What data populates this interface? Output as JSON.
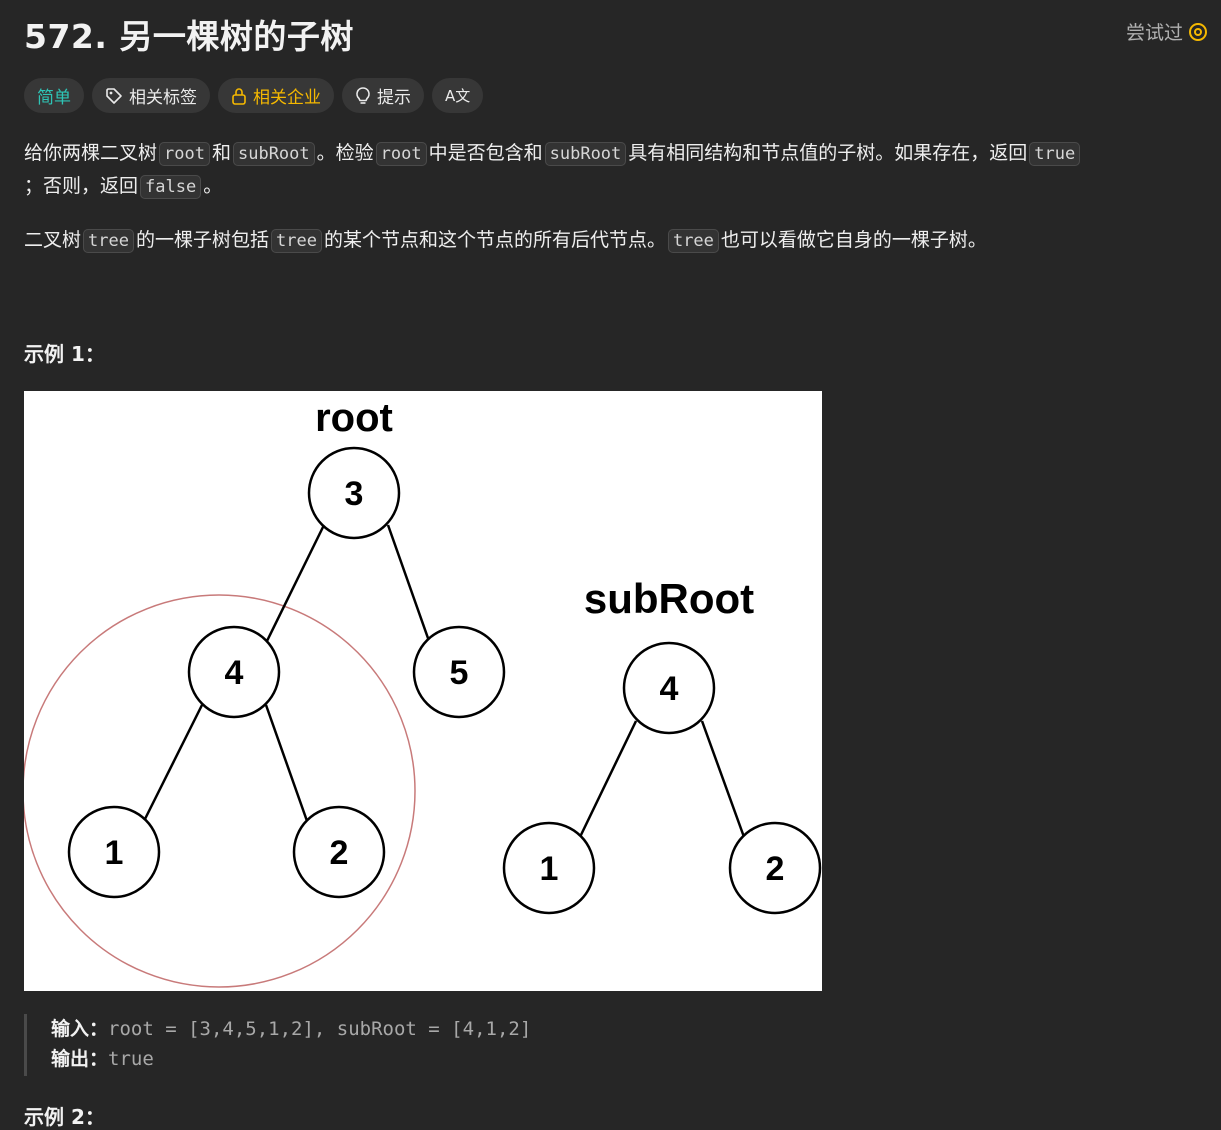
{
  "problem": {
    "title": "572. 另一棵树的子树",
    "tried_label": "尝试过"
  },
  "tags": {
    "difficulty": "简单",
    "related_tags": "相关标签",
    "related_companies": "相关企业",
    "hint": "提示",
    "translate": "A文"
  },
  "description": {
    "p1": {
      "t1": "给你两棵二叉树",
      "c1": "root",
      "t2": "和",
      "c2": "subRoot",
      "t3": "。检验",
      "c3": "root",
      "t4": "中是否包含和",
      "c4": "subRoot",
      "t5": "具有相同结构和节点值的子树。如果存在，返回",
      "c5": "true",
      "t6": "；否则，返回",
      "c6": "false",
      "t7": "。"
    },
    "p2": {
      "t1": "二叉树",
      "c1": "tree",
      "t2": "的一棵子树包括",
      "c2": "tree",
      "t3": "的某个节点和这个节点的所有后代节点。",
      "c3": "tree",
      "t4": "也可以看做它自身的一棵子树。"
    }
  },
  "example1": {
    "title": "示例 1：",
    "figure": {
      "root_label": "root",
      "subroot_label": "subRoot",
      "root_nodes": [
        "3",
        "4",
        "5",
        "1",
        "2"
      ],
      "sub_nodes": [
        "4",
        "1",
        "2"
      ]
    },
    "input_label": "输入：",
    "input_value": "root = [3,4,5,1,2], subRoot = [4,1,2]",
    "output_label": "输出：",
    "output_value": "true"
  },
  "example2": {
    "title": "示例 2："
  },
  "colors": {
    "easy": "#2ec4b6",
    "company": "#f5b800",
    "highlight_circle": "#c87a7a"
  }
}
